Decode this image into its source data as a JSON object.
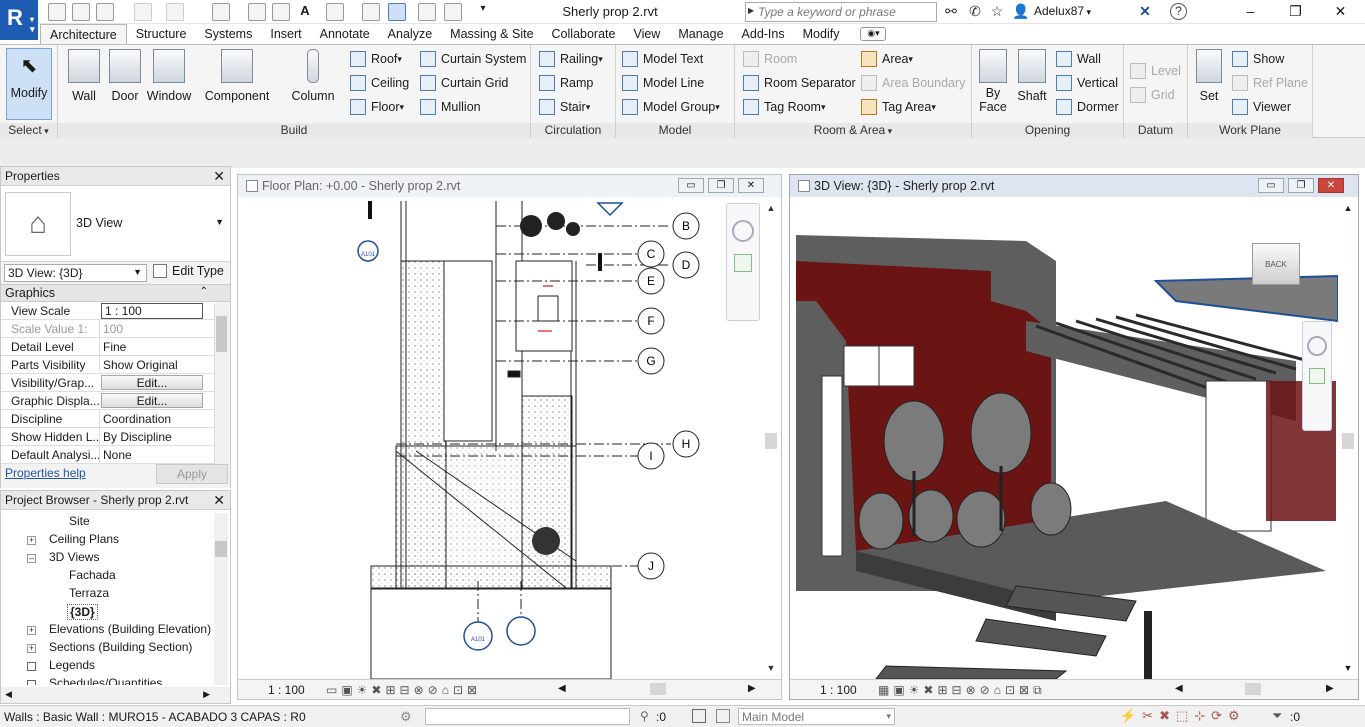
{
  "title_bar": {
    "logo_letter": "R",
    "document_title": "Sherly prop 2.rvt",
    "search_placeholder": "Type a keyword or phrase",
    "user": "Adelux87"
  },
  "tabs": [
    "Architecture",
    "Structure",
    "Systems",
    "Insert",
    "Annotate",
    "Analyze",
    "Massing & Site",
    "Collaborate",
    "View",
    "Manage",
    "Add-Ins",
    "Modify"
  ],
  "ribbon": {
    "select": {
      "modify": "Modify",
      "label": "Select"
    },
    "build": {
      "label": "Build",
      "wall": "Wall",
      "door": "Door",
      "window": "Window",
      "component": "Component",
      "column": "Column",
      "roof": "Roof",
      "ceiling": "Ceiling",
      "floor": "Floor",
      "curtain_system": "Curtain System",
      "curtain_grid": "Curtain Grid",
      "mullion": "Mullion"
    },
    "circulation": {
      "label": "Circulation",
      "railing": "Railing",
      "ramp": "Ramp",
      "stair": "Stair"
    },
    "model": {
      "label": "Model",
      "model_text": "Model Text",
      "model_line": "Model Line",
      "model_group": "Model Group"
    },
    "room_area": {
      "label": "Room & Area",
      "room": "Room",
      "room_separator": "Room Separator",
      "tag_room": "Tag Room",
      "area": "Area",
      "area_boundary": "Area Boundary",
      "tag_area": "Tag Area"
    },
    "opening": {
      "label": "Opening",
      "by_face_1": "By",
      "by_face_2": "Face",
      "shaft": "Shaft",
      "wall": "Wall",
      "vertical": "Vertical",
      "dormer": "Dormer"
    },
    "datum": {
      "label": "Datum",
      "level": "Level",
      "grid": "Grid"
    },
    "work_plane": {
      "label": "Work Plane",
      "set": "Set",
      "show": "Show",
      "ref_plane": "Ref Plane",
      "viewer": "Viewer"
    }
  },
  "properties": {
    "header": "Properties",
    "type_name": "3D View",
    "instance_selector": "3D View: {3D}",
    "edit_type": "Edit Type",
    "group": "Graphics",
    "rows": [
      {
        "key": "View Scale",
        "value": "1 : 100"
      },
      {
        "key": "Scale Value    1:",
        "value": "100"
      },
      {
        "key": "Detail Level",
        "value": "Fine"
      },
      {
        "key": "Parts Visibility",
        "value": "Show Original"
      },
      {
        "key": "Visibility/Grap...",
        "value": "Edit..."
      },
      {
        "key": "Graphic Displa...",
        "value": "Edit..."
      },
      {
        "key": "Discipline",
        "value": "Coordination"
      },
      {
        "key": "Show Hidden L...",
        "value": "By Discipline"
      },
      {
        "key": "Default Analysi...",
        "value": "None"
      }
    ],
    "help": "Properties help",
    "apply": "Apply"
  },
  "project_browser": {
    "header": "Project Browser - Sherly prop 2.rvt",
    "items": [
      "Site",
      "Ceiling Plans",
      "3D Views",
      "Fachada",
      "Terraza",
      "{3D}",
      "Elevations (Building Elevation)",
      "Sections (Building Section)",
      "Legends",
      "Schedules/Quantities"
    ]
  },
  "floor_plan_view": {
    "title": "Floor Plan: +0.00 - Sherly prop 2.rvt",
    "scale": "1 : 100",
    "grid_labels": [
      "B",
      "C",
      "D",
      "E",
      "F",
      "G",
      "H",
      "I",
      "J"
    ],
    "section_tag": "A101"
  },
  "view_3d": {
    "title": "3D View: {3D} - Sherly prop 2.rvt",
    "scale": "1 : 100",
    "viewcube_face": "BACK"
  },
  "status_bar": {
    "message": "Walls : Basic Wall : MURO15 - ACABADO 3 CAPAS : R0",
    "count_left": ":0",
    "model": "Main Model",
    "filter_count": ":0"
  },
  "colors": {
    "revit_blue": "#1e5cb3",
    "wall_red": "#6b1414",
    "grid_blue": "#1f4e9c"
  }
}
